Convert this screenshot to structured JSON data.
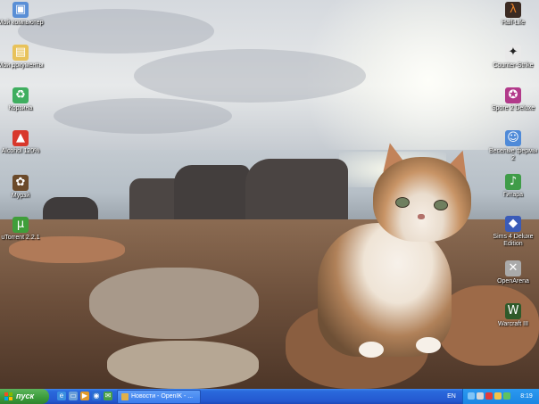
{
  "desktop": {
    "icons_left": [
      {
        "label": "Мой компьютер",
        "icon": "computer-icon",
        "glyph": "▣",
        "color": "#5a8fd6"
      },
      {
        "label": "Мои документы",
        "icon": "folder-icon",
        "glyph": "▤",
        "color": "#e8c25a"
      },
      {
        "label": "Корзина",
        "icon": "recycle-bin-icon",
        "glyph": "♻",
        "color": "#3fae5f"
      },
      {
        "label": "Alcohol 120%",
        "icon": "alcohol-icon",
        "glyph": "▲",
        "color": "#d8382c"
      },
      {
        "label": "Мурзй",
        "icon": "cat-app-icon",
        "glyph": "✿",
        "color": "#6b4a2a"
      },
      {
        "label": "uTorrent 2.2.1",
        "icon": "utorrent-icon",
        "glyph": "µ",
        "color": "#3f9e3a"
      }
    ],
    "icons_right": [
      {
        "label": "Half-Life",
        "icon": "half-life-icon",
        "glyph": "λ",
        "color": "#3a2a22"
      },
      {
        "label": "Counter-Strike",
        "icon": "counter-strike-icon",
        "glyph": "✦",
        "color": "#e9e9e9"
      },
      {
        "label": "Spore 2 Deluxe",
        "icon": "spore-icon",
        "glyph": "✪",
        "color": "#b23a8a"
      },
      {
        "label": "Веселые фермы 2",
        "icon": "farm-game-icon",
        "glyph": "☺",
        "color": "#4f8ad8"
      },
      {
        "label": "Гитара",
        "icon": "guitar-icon",
        "glyph": "♪",
        "color": "#3f9c48"
      },
      {
        "label": "Sims 4 Deluxe Edition",
        "icon": "sims-icon",
        "glyph": "◆",
        "color": "#3a5bb8"
      },
      {
        "label": "OpenArena",
        "icon": "openarena-icon",
        "glyph": "✕",
        "color": "#aaaaaa"
      },
      {
        "label": "Warcraft III",
        "icon": "warcraft-icon",
        "glyph": "W",
        "color": "#2f5a2a"
      }
    ]
  },
  "taskbar": {
    "start_label": "пуск",
    "quick_launch": [
      "ie-icon",
      "show-desktop-icon",
      "media-player-icon",
      "browser-icon",
      "messenger-icon"
    ],
    "active_task": "Новости - OpenIK - ...",
    "language": "EN",
    "tray_icons": [
      "network-icon",
      "volume-icon",
      "antivirus-icon",
      "update-icon",
      "safely-remove-icon"
    ],
    "clock": "8:19"
  }
}
